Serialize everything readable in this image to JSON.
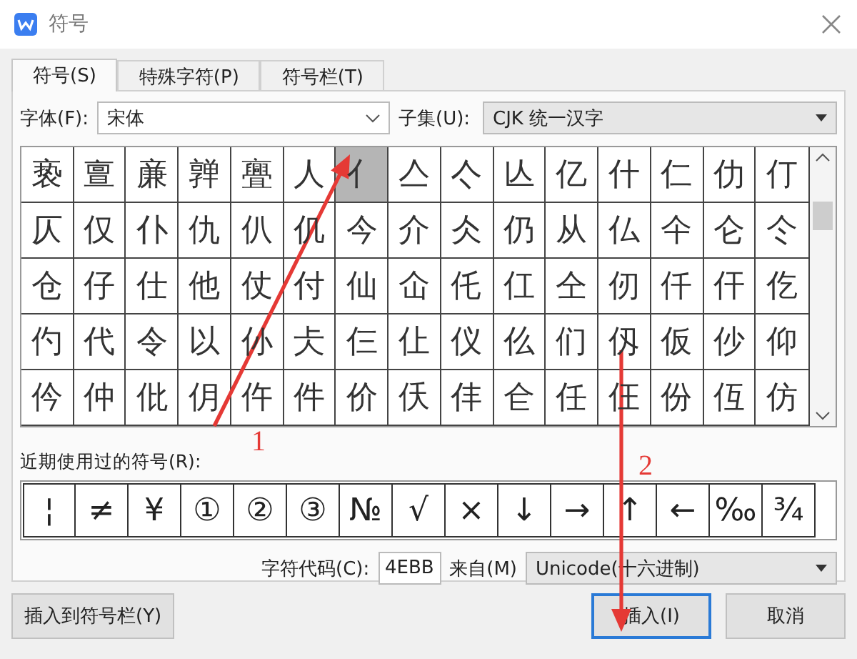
{
  "window": {
    "title": "符号"
  },
  "tabs": [
    {
      "label": "符号(S)",
      "selected": true
    },
    {
      "label": "特殊字符(P)",
      "selected": false
    },
    {
      "label": "符号栏(T)",
      "selected": false
    }
  ],
  "font": {
    "label": "字体(F):",
    "value": "宋体"
  },
  "subset": {
    "label": "子集(U):",
    "value": "CJK 统一汉字"
  },
  "grid": [
    [
      {
        "char": "亵",
        "selected": false
      },
      {
        "char": "亶",
        "selected": false
      },
      {
        "char": "亷",
        "selected": false
      },
      {
        "char": "亸",
        "selected": false
      },
      {
        "char": "亹",
        "selected": false
      },
      {
        "char": "人",
        "selected": false
      },
      {
        "char": "亻",
        "selected": true
      },
      {
        "char": "亼",
        "selected": false
      },
      {
        "char": "亽",
        "selected": false
      },
      {
        "char": "亾",
        "selected": false
      },
      {
        "char": "亿",
        "selected": false
      },
      {
        "char": "什",
        "selected": false
      },
      {
        "char": "仁",
        "selected": false
      },
      {
        "char": "仂",
        "selected": false
      },
      {
        "char": "仃",
        "selected": false
      }
    ],
    [
      {
        "char": "仄",
        "selected": false
      },
      {
        "char": "仅",
        "selected": false
      },
      {
        "char": "仆",
        "selected": false
      },
      {
        "char": "仇",
        "selected": false
      },
      {
        "char": "仈",
        "selected": false
      },
      {
        "char": "仉",
        "selected": false
      },
      {
        "char": "今",
        "selected": false
      },
      {
        "char": "介",
        "selected": false
      },
      {
        "char": "仌",
        "selected": false
      },
      {
        "char": "仍",
        "selected": false
      },
      {
        "char": "从",
        "selected": false
      },
      {
        "char": "仏",
        "selected": false
      },
      {
        "char": "仐",
        "selected": false
      },
      {
        "char": "仑",
        "selected": false
      },
      {
        "char": "仒",
        "selected": false
      }
    ],
    [
      {
        "char": "仓",
        "selected": false
      },
      {
        "char": "仔",
        "selected": false
      },
      {
        "char": "仕",
        "selected": false
      },
      {
        "char": "他",
        "selected": false
      },
      {
        "char": "仗",
        "selected": false
      },
      {
        "char": "付",
        "selected": false
      },
      {
        "char": "仙",
        "selected": false
      },
      {
        "char": "仚",
        "selected": false
      },
      {
        "char": "仛",
        "selected": false
      },
      {
        "char": "仜",
        "selected": false
      },
      {
        "char": "仝",
        "selected": false
      },
      {
        "char": "仞",
        "selected": false
      },
      {
        "char": "仟",
        "selected": false
      },
      {
        "char": "仠",
        "selected": false
      },
      {
        "char": "仡",
        "selected": false
      }
    ],
    [
      {
        "char": "仢",
        "selected": false
      },
      {
        "char": "代",
        "selected": false
      },
      {
        "char": "令",
        "selected": false
      },
      {
        "char": "以",
        "selected": false
      },
      {
        "char": "仦",
        "selected": false
      },
      {
        "char": "仧",
        "selected": false
      },
      {
        "char": "仨",
        "selected": false
      },
      {
        "char": "仩",
        "selected": false
      },
      {
        "char": "仪",
        "selected": false
      },
      {
        "char": "仫",
        "selected": false
      },
      {
        "char": "们",
        "selected": false
      },
      {
        "char": "仭",
        "selected": false
      },
      {
        "char": "仮",
        "selected": false
      },
      {
        "char": "仯",
        "selected": false
      },
      {
        "char": "仰",
        "selected": false
      }
    ],
    [
      {
        "char": "仱",
        "selected": false
      },
      {
        "char": "仲",
        "selected": false
      },
      {
        "char": "仳",
        "selected": false
      },
      {
        "char": "仴",
        "selected": false
      },
      {
        "char": "仵",
        "selected": false
      },
      {
        "char": "件",
        "selected": false
      },
      {
        "char": "价",
        "selected": false
      },
      {
        "char": "仸",
        "selected": false
      },
      {
        "char": "仹",
        "selected": false
      },
      {
        "char": "仺",
        "selected": false
      },
      {
        "char": "任",
        "selected": false
      },
      {
        "char": "仼",
        "selected": false
      },
      {
        "char": "份",
        "selected": false
      },
      {
        "char": "仾",
        "selected": false
      },
      {
        "char": "仿",
        "selected": false
      }
    ]
  ],
  "recent": {
    "label": "近期使用过的符号(R):",
    "symbols": [
      "¦",
      "≠",
      "¥",
      "①",
      "②",
      "③",
      "№",
      "√",
      "×",
      "↓",
      "→",
      "↑",
      "←",
      "‰",
      "¾"
    ]
  },
  "char_code": {
    "label": "字符代码(C):",
    "value": "4EBB"
  },
  "from": {
    "label": "来自(M)",
    "value": "Unicode(十六进制)"
  },
  "buttons": [
    {
      "label": "插入到符号栏(Y)",
      "kind": "secondary"
    },
    {
      "label": "插入(I)",
      "kind": "default"
    },
    {
      "label": "取消",
      "kind": "secondary"
    }
  ],
  "annotations": [
    {
      "label": "1"
    },
    {
      "label": "2"
    }
  ]
}
